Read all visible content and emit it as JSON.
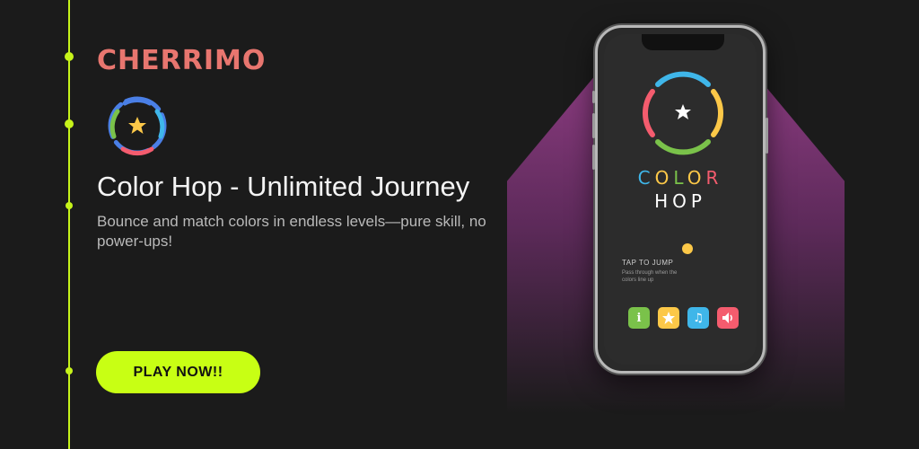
{
  "brand": {
    "name": "CHERRIMO"
  },
  "app": {
    "title": "Color Hop - Unlimited Journey",
    "description": "Bounce and match colors in endless levels—pure skill, no power-ups!"
  },
  "cta": {
    "play_label": "PLAY NOW!!"
  },
  "phone_screen": {
    "logo_line1": [
      "C",
      "O",
      "L",
      "O",
      "R"
    ],
    "logo_line2": "HOP",
    "tap_title": "TAP TO JUMP",
    "tap_subtitle": "Pass through when the colors line up"
  },
  "colors": {
    "background": "#1b1b1b",
    "accent": "#c8ff14",
    "brand": "#e8766f",
    "ring_blue": "#3fb6e9",
    "ring_yellow": "#fcc848",
    "ring_green": "#7ac24a",
    "ring_red": "#f45c6e"
  },
  "icons": [
    "star-icon",
    "info-icon",
    "music-icon",
    "sound-icon"
  ]
}
